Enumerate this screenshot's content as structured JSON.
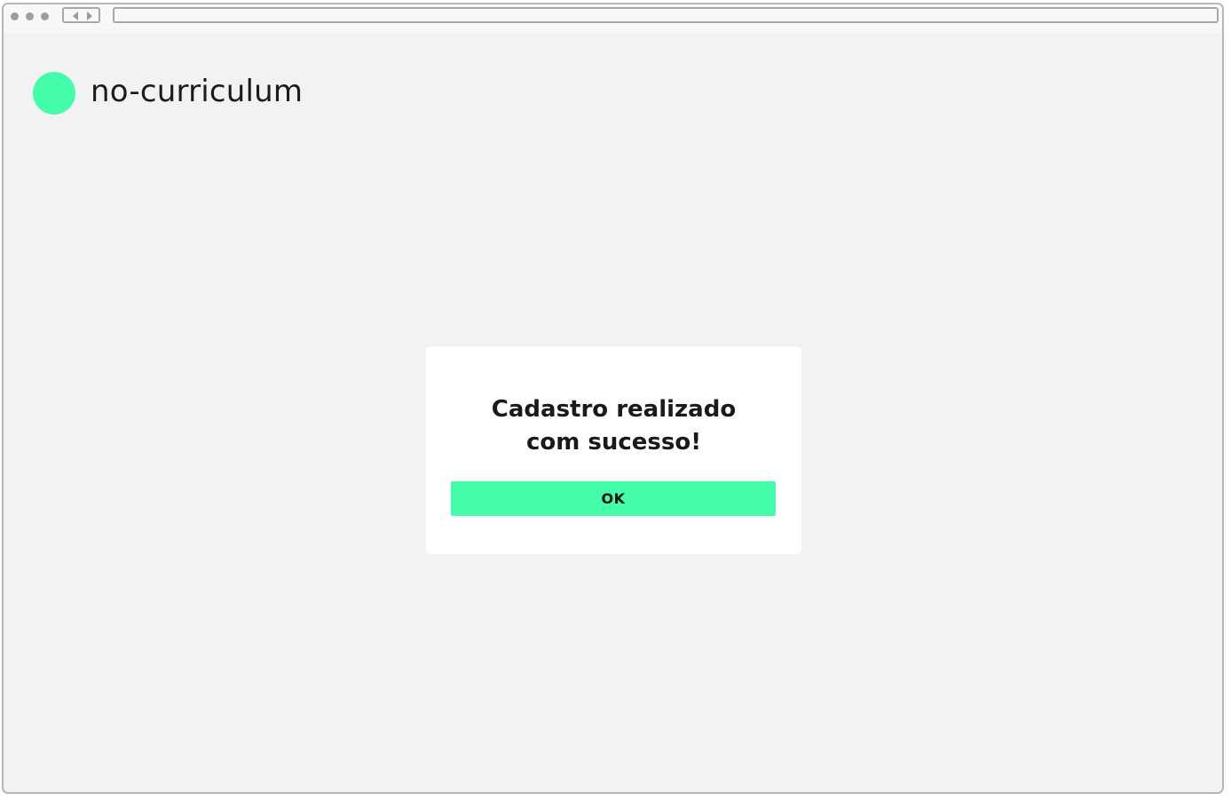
{
  "browser": {
    "window_controls": [
      "dot",
      "dot",
      "dot"
    ],
    "nav_icons": [
      "arrow-left-icon",
      "arrow-right-icon"
    ],
    "address": ""
  },
  "header": {
    "brand_name": "no-curriculum",
    "logo_color": "#43fda8"
  },
  "modal": {
    "title_line_1": "Cadastro realizado",
    "title_line_2": "com sucesso!",
    "ok_label": "OK",
    "button_color": "#43fda8"
  },
  "colors": {
    "background": "#f2f2f2",
    "card": "#ffffff",
    "accent": "#43fda8",
    "text": "#1a1a1a"
  }
}
